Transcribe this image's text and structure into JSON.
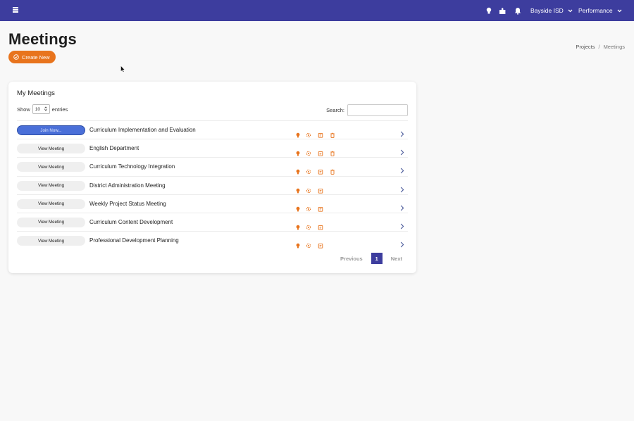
{
  "topbar": {
    "org_label": "Bayside ISD",
    "performance_label": "Performance",
    "bg_color": "#3d3d9e"
  },
  "header": {
    "title": "Meetings",
    "create_label": "Create New",
    "breadcrumb": {
      "parent": "Projects",
      "separator": "/",
      "current": "Meetings"
    }
  },
  "card": {
    "title": "My Meetings",
    "show_label": "Show",
    "entries_value": "10",
    "entries_label": "entries",
    "search_label": "Search:",
    "search_value": "",
    "rows": [
      {
        "button": "Join Now...",
        "name": "Curriculum Implementation and Evaluation"
      },
      {
        "button": "View Meeting",
        "name": "English Department"
      },
      {
        "button": "View Meeting",
        "name": "Curriculum Technology Integration"
      },
      {
        "button": "View Meeting",
        "name": "District Administration Meeting"
      },
      {
        "button": "View Meeting",
        "name": "Weekly Project Status Meeting"
      },
      {
        "button": "View Meeting",
        "name": "Curriculum Content Development"
      },
      {
        "button": "View Meeting",
        "name": "Professional Development Planning"
      }
    ],
    "pager": {
      "previous": "Previous",
      "current_page": "1",
      "next": "Next"
    }
  },
  "colors": {
    "accent": "#e8741d",
    "primary": "#3d3d9e",
    "join_button": "#4a6fd8"
  },
  "icons": [
    "hamburger-icon",
    "lightbulb-icon",
    "puzzle-icon",
    "bell-icon",
    "chevron-down-icon",
    "check-circle-icon",
    "gear-icon",
    "clipboard-icon",
    "trash-icon",
    "chevron-right-icon"
  ]
}
